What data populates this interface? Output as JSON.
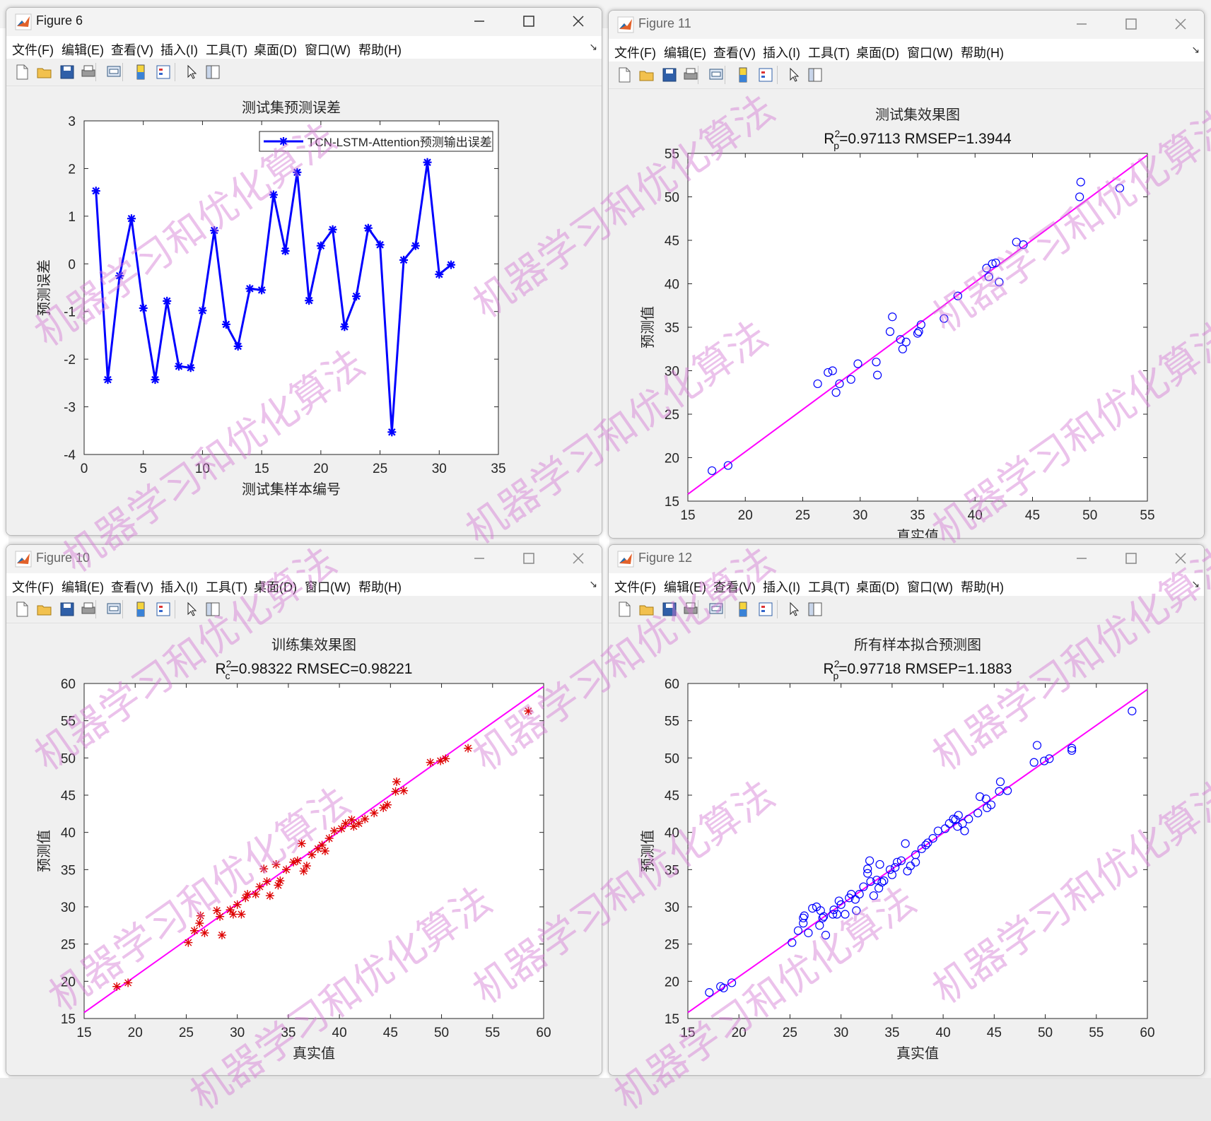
{
  "watermark": "机器学习和优化算法",
  "colors": {
    "blue": "#0000ff",
    "magenta": "#ff00ff",
    "red": "#dd0000",
    "grid": "#e6e6e6"
  },
  "menu": [
    "文件(F)",
    "编辑(E)",
    "查看(V)",
    "插入(I)",
    "工具(T)",
    "桌面(D)",
    "窗口(W)",
    "帮助(H)"
  ],
  "toolbar_icons": [
    "new-file-icon",
    "open-folder-icon",
    "save-icon",
    "print-icon",
    "print-preview-icon",
    "colorbar-icon",
    "legend-icon",
    "pointer-icon",
    "property-editor-icon"
  ],
  "windows": [
    {
      "id": "fig6",
      "title": "Figure 6"
    },
    {
      "id": "fig11",
      "title": "Figure 11"
    },
    {
      "id": "fig10",
      "title": "Figure 10"
    },
    {
      "id": "fig12",
      "title": "Figure 12"
    }
  ],
  "chart_data": [
    {
      "type": "line",
      "title": "测试集预测误差",
      "xlabel": "测试集样本编号",
      "ylabel": "预测误差",
      "xlim": [
        0,
        35
      ],
      "ylim": [
        -4,
        3
      ],
      "xticks": [
        0,
        5,
        10,
        15,
        20,
        25,
        30,
        35
      ],
      "yticks": [
        -4,
        -3,
        -2,
        -1,
        0,
        1,
        2,
        3
      ],
      "grid": false,
      "legend_position": "top-right",
      "series": [
        {
          "name": "TCN-LSTM-Attention预测输出误差",
          "color": "#0000ff",
          "x": [
            1,
            2,
            3,
            4,
            5,
            6,
            7,
            8,
            9,
            10,
            11,
            12,
            13,
            14,
            15,
            16,
            17,
            18,
            19,
            20,
            21,
            22,
            23,
            24,
            25,
            26,
            27,
            28,
            29,
            30,
            31
          ],
          "y": [
            1.53,
            -2.43,
            -0.25,
            0.95,
            -0.93,
            -2.43,
            -0.78,
            -2.15,
            -2.18,
            -0.98,
            0.7,
            -1.27,
            -1.73,
            -0.52,
            -0.55,
            1.45,
            0.27,
            1.92,
            -0.77,
            0.38,
            0.72,
            -1.32,
            -0.68,
            0.75,
            0.4,
            -3.53,
            0.08,
            0.38,
            2.13,
            -0.22,
            -0.02
          ]
        }
      ]
    },
    {
      "type": "scatter",
      "title": "测试集效果图",
      "subtitle": {
        "base": "R",
        "sup": "2",
        "sub": "p",
        "rest": "=0.97113  RMSEP=1.3944"
      },
      "xlabel": "真实值",
      "ylabel": "预测值",
      "xlim": [
        15,
        55
      ],
      "ylim": [
        15,
        55
      ],
      "xticks": [
        15,
        20,
        25,
        30,
        35,
        40,
        45,
        50,
        55
      ],
      "yticks": [
        15,
        20,
        25,
        30,
        35,
        40,
        45,
        50,
        55
      ],
      "marker": "circle",
      "marker_color": "#0000ff",
      "fit_line": [
        [
          15,
          15.8
        ],
        [
          55,
          54.8
        ]
      ],
      "line_color": "#ff00ff",
      "points": [
        [
          17.1,
          18.5
        ],
        [
          18.5,
          19.1
        ],
        [
          26.3,
          28.5
        ],
        [
          27.2,
          29.8
        ],
        [
          27.6,
          30
        ],
        [
          27.9,
          27.5
        ],
        [
          28.2,
          28.5
        ],
        [
          29.2,
          29
        ],
        [
          29.8,
          30.8
        ],
        [
          31.4,
          31
        ],
        [
          31.5,
          29.5
        ],
        [
          32.6,
          34.5
        ],
        [
          32.8,
          36.2
        ],
        [
          33.5,
          33.6
        ],
        [
          33.7,
          32.5
        ],
        [
          34,
          33.3
        ],
        [
          35,
          34.3
        ],
        [
          35.1,
          34.5
        ],
        [
          35.3,
          35.3
        ],
        [
          37.3,
          36
        ],
        [
          38.5,
          38.6
        ],
        [
          41,
          41.8
        ],
        [
          41.2,
          40.8
        ],
        [
          41.5,
          42.3
        ],
        [
          41.8,
          42.4
        ],
        [
          42.1,
          40.2
        ],
        [
          43.6,
          44.8
        ],
        [
          44.2,
          44.5
        ],
        [
          49.1,
          50
        ],
        [
          49.2,
          51.7
        ],
        [
          52.6,
          51
        ]
      ]
    },
    {
      "type": "scatter",
      "title": "训练集效果图",
      "subtitle": {
        "base": "R",
        "sup": "2",
        "sub": "c",
        "rest": "=0.98322  RMSEC=0.98221"
      },
      "xlabel": "真实值",
      "ylabel": "预测值",
      "xlim": [
        15,
        60
      ],
      "ylim": [
        15,
        60
      ],
      "xticks": [
        15,
        20,
        25,
        30,
        35,
        40,
        45,
        50,
        55,
        60
      ],
      "yticks": [
        15,
        20,
        25,
        30,
        35,
        40,
        45,
        50,
        55,
        60
      ],
      "marker": "star",
      "marker_color": "#dd0000",
      "fit_line": [
        [
          15,
          15.8
        ],
        [
          60,
          59.6
        ]
      ],
      "line_color": "#ff00ff",
      "points": [
        [
          18.2,
          19.3
        ],
        [
          19.3,
          19.8
        ],
        [
          25.2,
          25.2
        ],
        [
          25.8,
          26.8
        ],
        [
          26.3,
          27.8
        ],
        [
          26.4,
          28.8
        ],
        [
          26.8,
          26.5
        ],
        [
          28,
          29.5
        ],
        [
          28.3,
          28.7
        ],
        [
          28.5,
          26.2
        ],
        [
          29.3,
          29.6
        ],
        [
          29.6,
          29
        ],
        [
          30,
          30.3
        ],
        [
          30.4,
          29
        ],
        [
          30.8,
          31.2
        ],
        [
          31,
          31.7
        ],
        [
          31.8,
          31.7
        ],
        [
          32.2,
          32.7
        ],
        [
          32.6,
          35.1
        ],
        [
          32.9,
          33.4
        ],
        [
          33.2,
          31.5
        ],
        [
          33.8,
          35.7
        ],
        [
          34,
          32.9
        ],
        [
          34.2,
          33.5
        ],
        [
          34.8,
          35
        ],
        [
          35.5,
          36
        ],
        [
          35.9,
          36.2
        ],
        [
          36.3,
          38.5
        ],
        [
          36.5,
          34.8
        ],
        [
          36.8,
          35.5
        ],
        [
          37.3,
          37
        ],
        [
          37.9,
          37.8
        ],
        [
          38.3,
          38.3
        ],
        [
          38.6,
          37.5
        ],
        [
          39,
          39.2
        ],
        [
          39.5,
          40.2
        ],
        [
          40.2,
          40.5
        ],
        [
          40.6,
          41.2
        ],
        [
          41.2,
          41.7
        ],
        [
          41.4,
          40.8
        ],
        [
          41.9,
          41.2
        ],
        [
          42.5,
          41.8
        ],
        [
          43.4,
          42.6
        ],
        [
          44.3,
          43.3
        ],
        [
          44.7,
          43.7
        ],
        [
          45.5,
          45.5
        ],
        [
          45.6,
          46.8
        ],
        [
          46.3,
          45.6
        ],
        [
          48.9,
          49.4
        ],
        [
          49.9,
          49.6
        ],
        [
          50.4,
          49.9
        ],
        [
          52.6,
          51.3
        ],
        [
          58.5,
          56.3
        ]
      ]
    },
    {
      "type": "scatter",
      "title": "所有样本拟合预测图",
      "subtitle": {
        "base": "R",
        "sup": "2",
        "sub": "p",
        "rest": "=0.97718  RMSEP=1.1883"
      },
      "xlabel": "真实值",
      "ylabel": "预测值",
      "xlim": [
        15,
        60
      ],
      "ylim": [
        15,
        60
      ],
      "xticks": [
        15,
        20,
        25,
        30,
        35,
        40,
        45,
        50,
        55,
        60
      ],
      "yticks": [
        15,
        20,
        25,
        30,
        35,
        40,
        45,
        50,
        55,
        60
      ],
      "marker": "circle",
      "marker_color": "#0000ff",
      "fit_line": [
        [
          15,
          15.8
        ],
        [
          60,
          59.2
        ]
      ],
      "line_color": "#ff00ff",
      "points": [
        [
          17.1,
          18.5
        ],
        [
          18.2,
          19.3
        ],
        [
          18.5,
          19.1
        ],
        [
          19.3,
          19.8
        ],
        [
          25.2,
          25.2
        ],
        [
          25.8,
          26.8
        ],
        [
          26.3,
          27.8
        ],
        [
          26.3,
          28.5
        ],
        [
          26.4,
          28.8
        ],
        [
          26.8,
          26.5
        ],
        [
          27.2,
          29.8
        ],
        [
          27.6,
          30
        ],
        [
          27.9,
          27.5
        ],
        [
          28,
          29.5
        ],
        [
          28.2,
          28.5
        ],
        [
          28.3,
          28.7
        ],
        [
          28.5,
          26.2
        ],
        [
          29.2,
          29
        ],
        [
          29.3,
          29.6
        ],
        [
          29.6,
          29
        ],
        [
          29.8,
          30.8
        ],
        [
          30,
          30.3
        ],
        [
          30.4,
          29
        ],
        [
          30.8,
          31.2
        ],
        [
          31,
          31.7
        ],
        [
          31.4,
          31
        ],
        [
          31.5,
          29.5
        ],
        [
          31.8,
          31.7
        ],
        [
          32.2,
          32.7
        ],
        [
          32.6,
          34.5
        ],
        [
          32.6,
          35.1
        ],
        [
          32.8,
          36.2
        ],
        [
          32.9,
          33.4
        ],
        [
          33.2,
          31.5
        ],
        [
          33.5,
          33.6
        ],
        [
          33.7,
          32.5
        ],
        [
          33.8,
          35.7
        ],
        [
          34,
          33.3
        ],
        [
          34.2,
          33.5
        ],
        [
          34.8,
          35
        ],
        [
          35,
          34.3
        ],
        [
          35.3,
          35.3
        ],
        [
          35.5,
          36
        ],
        [
          35.9,
          36.2
        ],
        [
          36.3,
          38.5
        ],
        [
          36.5,
          34.8
        ],
        [
          36.8,
          35.5
        ],
        [
          37.3,
          36
        ],
        [
          37.3,
          37
        ],
        [
          37.9,
          37.8
        ],
        [
          38.3,
          38.3
        ],
        [
          38.5,
          38.6
        ],
        [
          39,
          39.2
        ],
        [
          39.5,
          40.2
        ],
        [
          40.2,
          40.5
        ],
        [
          40.6,
          41.2
        ],
        [
          41,
          41.8
        ],
        [
          41.2,
          41.7
        ],
        [
          41.4,
          40.8
        ],
        [
          41.5,
          42.3
        ],
        [
          41.9,
          41.2
        ],
        [
          42.1,
          40.2
        ],
        [
          42.5,
          41.8
        ],
        [
          43.4,
          42.6
        ],
        [
          43.6,
          44.8
        ],
        [
          44.2,
          44.5
        ],
        [
          44.3,
          43.3
        ],
        [
          44.7,
          43.7
        ],
        [
          45.5,
          45.5
        ],
        [
          45.6,
          46.8
        ],
        [
          46.3,
          45.6
        ],
        [
          48.9,
          49.4
        ],
        [
          49.2,
          51.7
        ],
        [
          49.9,
          49.6
        ],
        [
          50.4,
          49.9
        ],
        [
          52.6,
          51
        ],
        [
          52.6,
          51.3
        ],
        [
          58.5,
          56.3
        ]
      ]
    }
  ]
}
